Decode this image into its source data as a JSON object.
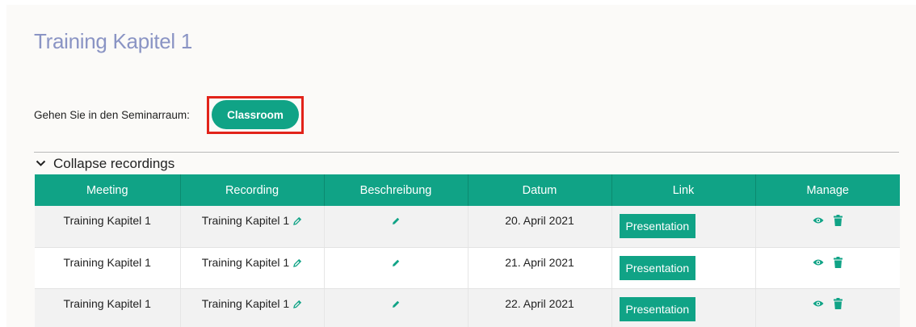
{
  "page": {
    "title": "Training Kapitel 1"
  },
  "room": {
    "label": "Gehen Sie in den Seminarraum:",
    "button_label": "Classroom"
  },
  "recordings": {
    "collapse_label": "Collapse recordings",
    "columns": [
      "Meeting",
      "Recording",
      "Beschreibung",
      "Datum",
      "Link",
      "Manage"
    ],
    "rows": [
      {
        "meeting": "Training Kapitel 1",
        "recording": "Training Kapitel 1",
        "datum": "20. April 2021",
        "link_label": "Presentation"
      },
      {
        "meeting": "Training Kapitel 1",
        "recording": "Training Kapitel 1",
        "datum": "21. April 2021",
        "link_label": "Presentation"
      },
      {
        "meeting": "Training Kapitel 1",
        "recording": "Training Kapitel 1",
        "datum": "22. April 2021",
        "link_label": "Presentation"
      }
    ]
  },
  "icons": {
    "collapse": "chevron-down-icon",
    "edit": "pencil-icon",
    "view": "eye-icon",
    "delete": "trash-icon"
  },
  "colors": {
    "accent": "#10a386",
    "title": "#8a94c4",
    "highlight_border": "#e2231a"
  }
}
